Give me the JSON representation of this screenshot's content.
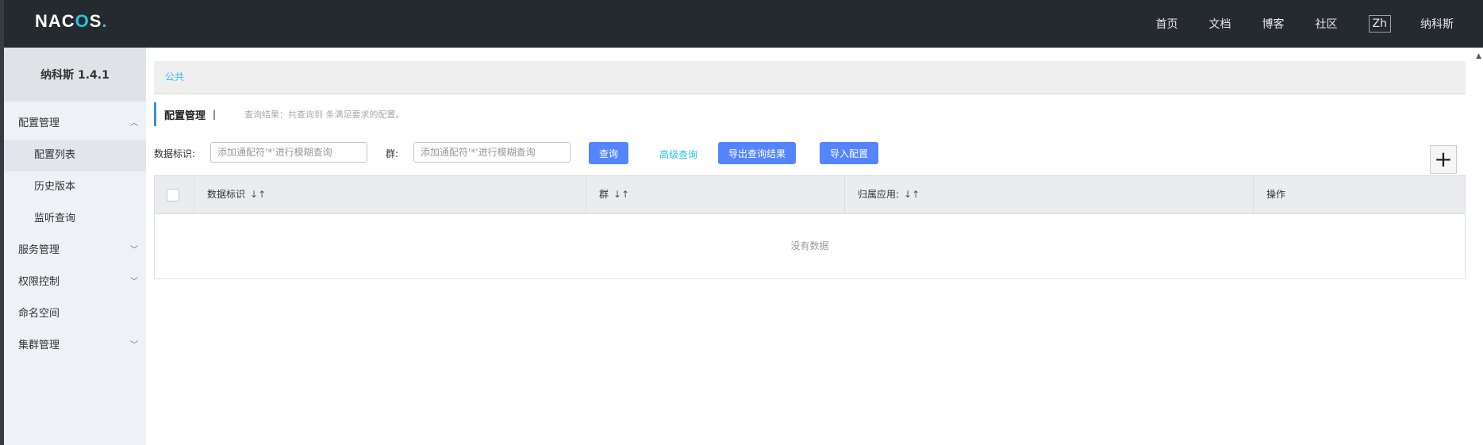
{
  "app": {
    "logo_prefix": "NAC",
    "logo_o": "O",
    "logo_suffix": "S",
    "logo_dot": ".",
    "version_title": "纳科斯 1.4.1"
  },
  "topnav": {
    "items": [
      "首页",
      "文档",
      "博客",
      "社区"
    ],
    "lang": "Zh",
    "user": "纳科斯"
  },
  "sidebar": {
    "groups": [
      {
        "label": "配置管理",
        "expanded": true,
        "children": [
          "配置列表",
          "历史版本",
          "监听查询"
        ]
      },
      {
        "label": "服务管理",
        "expanded": false
      },
      {
        "label": "权限控制",
        "expanded": false
      },
      {
        "label": "命名空间",
        "expanded": false,
        "leaf": true
      },
      {
        "label": "集群管理",
        "expanded": false
      }
    ]
  },
  "breadcrumb": {
    "namespace": "公共"
  },
  "page": {
    "title": "配置管理",
    "separator": "|",
    "query_info": "查询结果：共查询到 条满足要求的配置。"
  },
  "filters": {
    "data_id_label": "数据标识:",
    "data_id_placeholder": "添加通配符'*'进行模糊查询",
    "group_label": "群:",
    "group_placeholder": "添加通配符'*'进行模糊查询",
    "query_button": "查询",
    "advanced_query": "高级查询",
    "export_button": "导出查询结果",
    "import_button": "导入配置",
    "add_symbol": "+"
  },
  "table": {
    "columns": [
      "数据标识",
      "群",
      "归属应用:",
      "操作"
    ],
    "sort_symbol": "↓↑",
    "empty_text": "没有数据"
  },
  "colors": {
    "topbar": "#252a2f",
    "sidebar": "#eef1f5",
    "primary": "#5584ff",
    "accent": "#2cc2de"
  }
}
